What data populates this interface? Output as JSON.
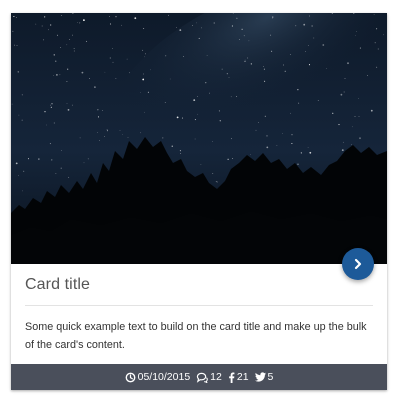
{
  "card": {
    "title": "Card title",
    "text": "Some quick example text to build on the card title and make up the bulk of the card's content.",
    "image_description_icon": "night-sky-image",
    "action_icon": "chevron-right-icon",
    "footer": {
      "date": "05/10/2015",
      "comments": "12",
      "facebook": "21",
      "twitter": "5"
    }
  },
  "colors": {
    "action_button": "#1d5a99",
    "footer_background": "#4a4f5b",
    "title_text": "#555555",
    "body_text": "#333333"
  }
}
